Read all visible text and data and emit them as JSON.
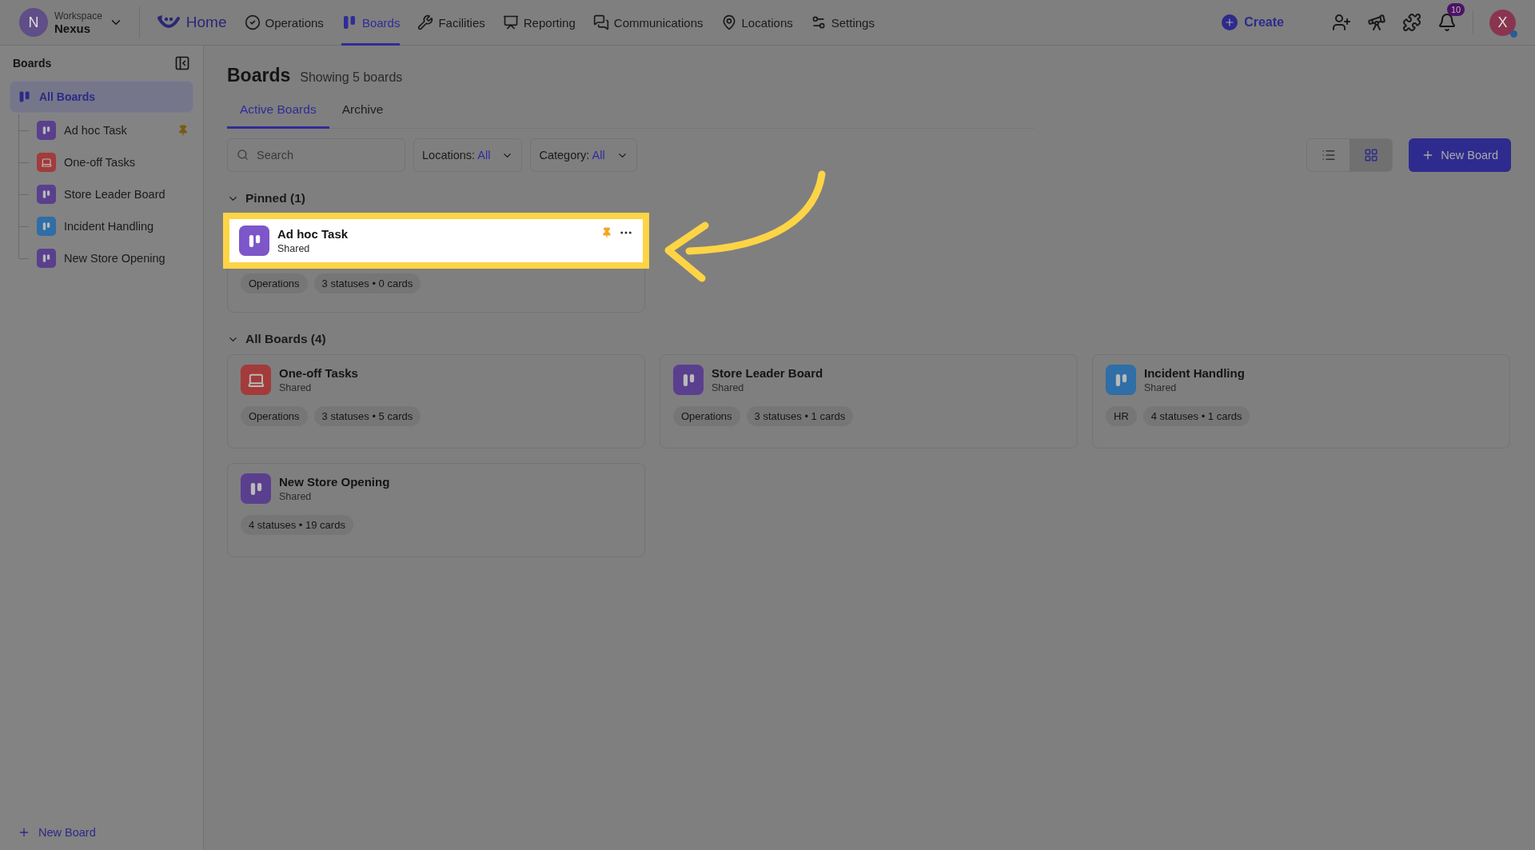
{
  "topbar": {
    "workspace": {
      "avatar": "N",
      "label": "Workspace",
      "name": "Nexus"
    },
    "home": "Home",
    "nav": [
      {
        "label": "Operations",
        "selected": false
      },
      {
        "label": "Boards",
        "selected": true
      },
      {
        "label": "Facilities",
        "selected": false
      },
      {
        "label": "Reporting",
        "selected": false
      },
      {
        "label": "Communications",
        "selected": false
      },
      {
        "label": "Locations",
        "selected": false
      },
      {
        "label": "Settings",
        "selected": false
      }
    ],
    "create": "Create",
    "notifications": "10",
    "avatar": "X"
  },
  "sidebar": {
    "title": "Boards",
    "root": {
      "label": "All Boards",
      "selected": true,
      "children": [
        {
          "label": "Ad hoc Task",
          "kind": "board",
          "color": "#5a3f8f",
          "pinned": true
        },
        {
          "label": "One-off Tasks",
          "kind": "laptop",
          "color": "#a33b3b",
          "pinned": false
        },
        {
          "label": "Store Leader Board",
          "kind": "board",
          "color": "#5a3f8f",
          "pinned": false
        },
        {
          "label": "Incident Handling",
          "kind": "board",
          "color": "#2f6ea6",
          "pinned": false
        },
        {
          "label": "New Store Opening",
          "kind": "board",
          "color": "#5a3f8f",
          "pinned": false
        }
      ]
    },
    "new_board": "New Board"
  },
  "main": {
    "title": "Boards",
    "subtitle": "Showing 5 boards",
    "tabs": [
      {
        "label": "Active Boards",
        "selected": true
      },
      {
        "label": "Archive",
        "selected": false
      }
    ],
    "search": {
      "placeholder": "Search"
    },
    "filters": [
      {
        "label": "Locations:",
        "value": "All"
      },
      {
        "label": "Category:",
        "value": "All"
      }
    ],
    "views": [
      {
        "kind": "list",
        "selected": false
      },
      {
        "kind": "grid",
        "selected": true
      }
    ],
    "new_board": "New Board",
    "sections": [
      {
        "title": "Pinned (1)",
        "expanded": true,
        "boards": [
          {
            "name": "Ad hoc Task",
            "subtitle": "Shared",
            "kind": "board",
            "color": "#7d56c9",
            "pinned": true,
            "highlighted": true,
            "tags": [
              "Operations",
              "3 statuses • 0 cards"
            ]
          }
        ]
      },
      {
        "title": "All Boards (4)",
        "expanded": true,
        "boards": [
          {
            "name": "One-off Tasks",
            "subtitle": "Shared",
            "kind": "laptop",
            "color": "#a33b3b",
            "highlighted": false,
            "tags": [
              "Operations",
              "3 statuses • 5 cards"
            ]
          },
          {
            "name": "Store Leader Board",
            "subtitle": "Shared",
            "kind": "board",
            "color": "#5a3f8f",
            "highlighted": false,
            "tags": [
              "Operations",
              "3 statuses • 1 cards"
            ]
          },
          {
            "name": "Incident Handling",
            "subtitle": "Shared",
            "kind": "board",
            "color": "#2f6ea6",
            "highlighted": false,
            "tags": [
              "HR",
              "4 statuses • 1 cards"
            ]
          },
          {
            "name": "New Store Opening",
            "subtitle": "Shared",
            "kind": "board",
            "color": "#5a3f8f",
            "highlighted": false,
            "tags": [
              "4 statuses • 19 cards"
            ]
          }
        ]
      }
    ]
  }
}
